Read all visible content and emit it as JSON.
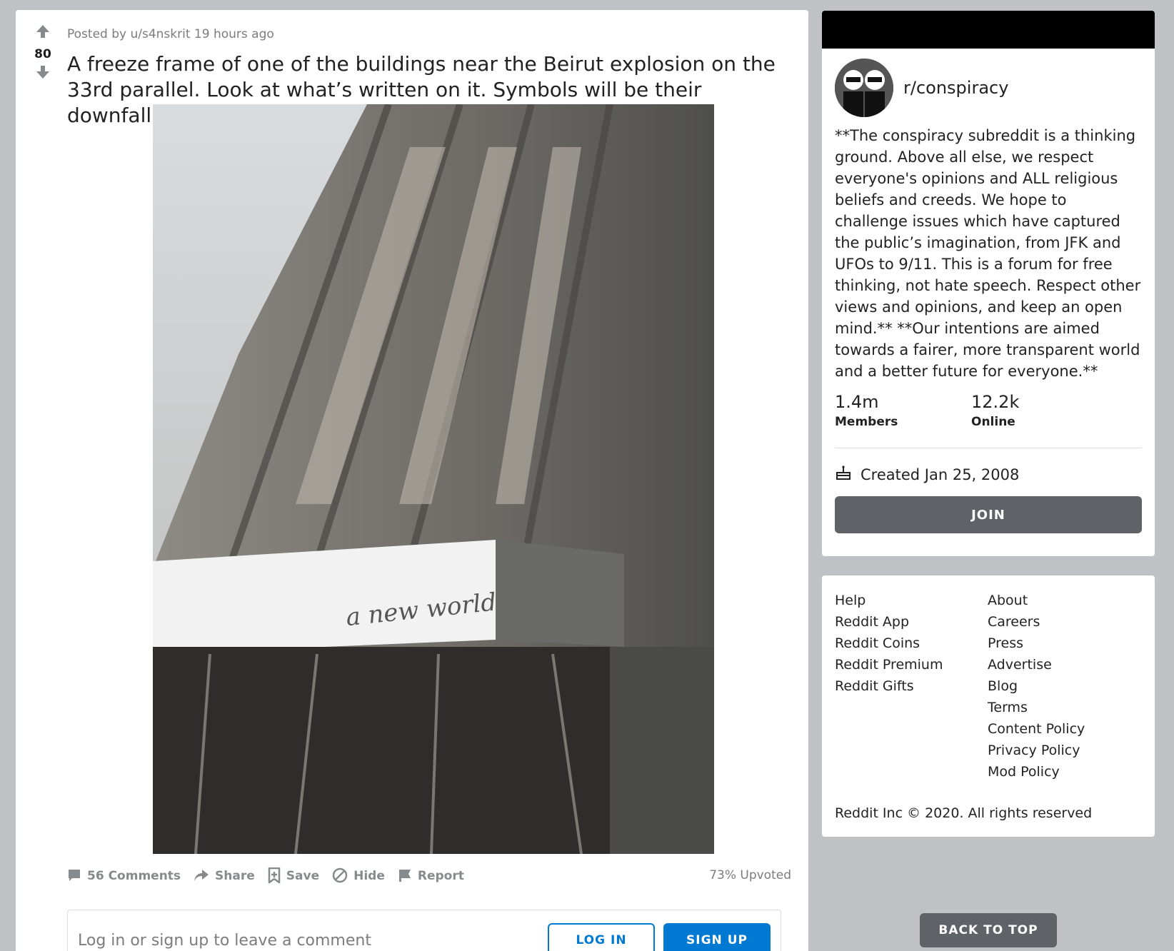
{
  "post": {
    "score": "80",
    "meta": "Posted by u/s4nskrit 19 hours ago",
    "title": "A freeze frame of one of the buildings near the Beirut explosion on the 33rd parallel. Look at what’s written on it. Symbols will be their downfall.",
    "image_sign_text": "a new world",
    "actions": {
      "comments": "56 Comments",
      "share": "Share",
      "save": "Save",
      "hide": "Hide",
      "report": "Report"
    },
    "upvoted": "73% Upvoted",
    "comment_prompt": "Log in or sign up to leave a comment",
    "login_label": "LOG IN",
    "signup_label": "SIGN UP"
  },
  "sidebar": {
    "community_name": "r/conspiracy",
    "description": "**The conspiracy subreddit is a thinking ground. Above all else, we respect everyone's opinions and ALL religious beliefs and creeds. We hope to challenge issues which have captured the public’s imagination, from JFK and UFOs to 9/11. This is a forum for free thinking, not hate speech. Respect other views and opinions, and keep an open mind.** **Our intentions are aimed towards a fairer, more transparent world and a better future for everyone.**",
    "members_count": "1.4m",
    "members_label": "Members",
    "online_count": "12.2k",
    "online_label": "Online",
    "created": "Created Jan 25, 2008",
    "join_label": "JOIN"
  },
  "footer": {
    "left_links": [
      "Help",
      "Reddit App",
      "Reddit Coins",
      "Reddit Premium",
      "Reddit Gifts"
    ],
    "right_links": [
      "About",
      "Careers",
      "Press",
      "Advertise",
      "Blog",
      "Terms",
      "Content Policy",
      "Privacy Policy",
      "Mod Policy"
    ],
    "copyright": "Reddit Inc © 2020. All rights reserved"
  },
  "back_to_top": "BACK TO TOP",
  "colors": {
    "accent": "#0079d3",
    "button_gray": "#5f6368",
    "background": "#bfc1c4"
  }
}
